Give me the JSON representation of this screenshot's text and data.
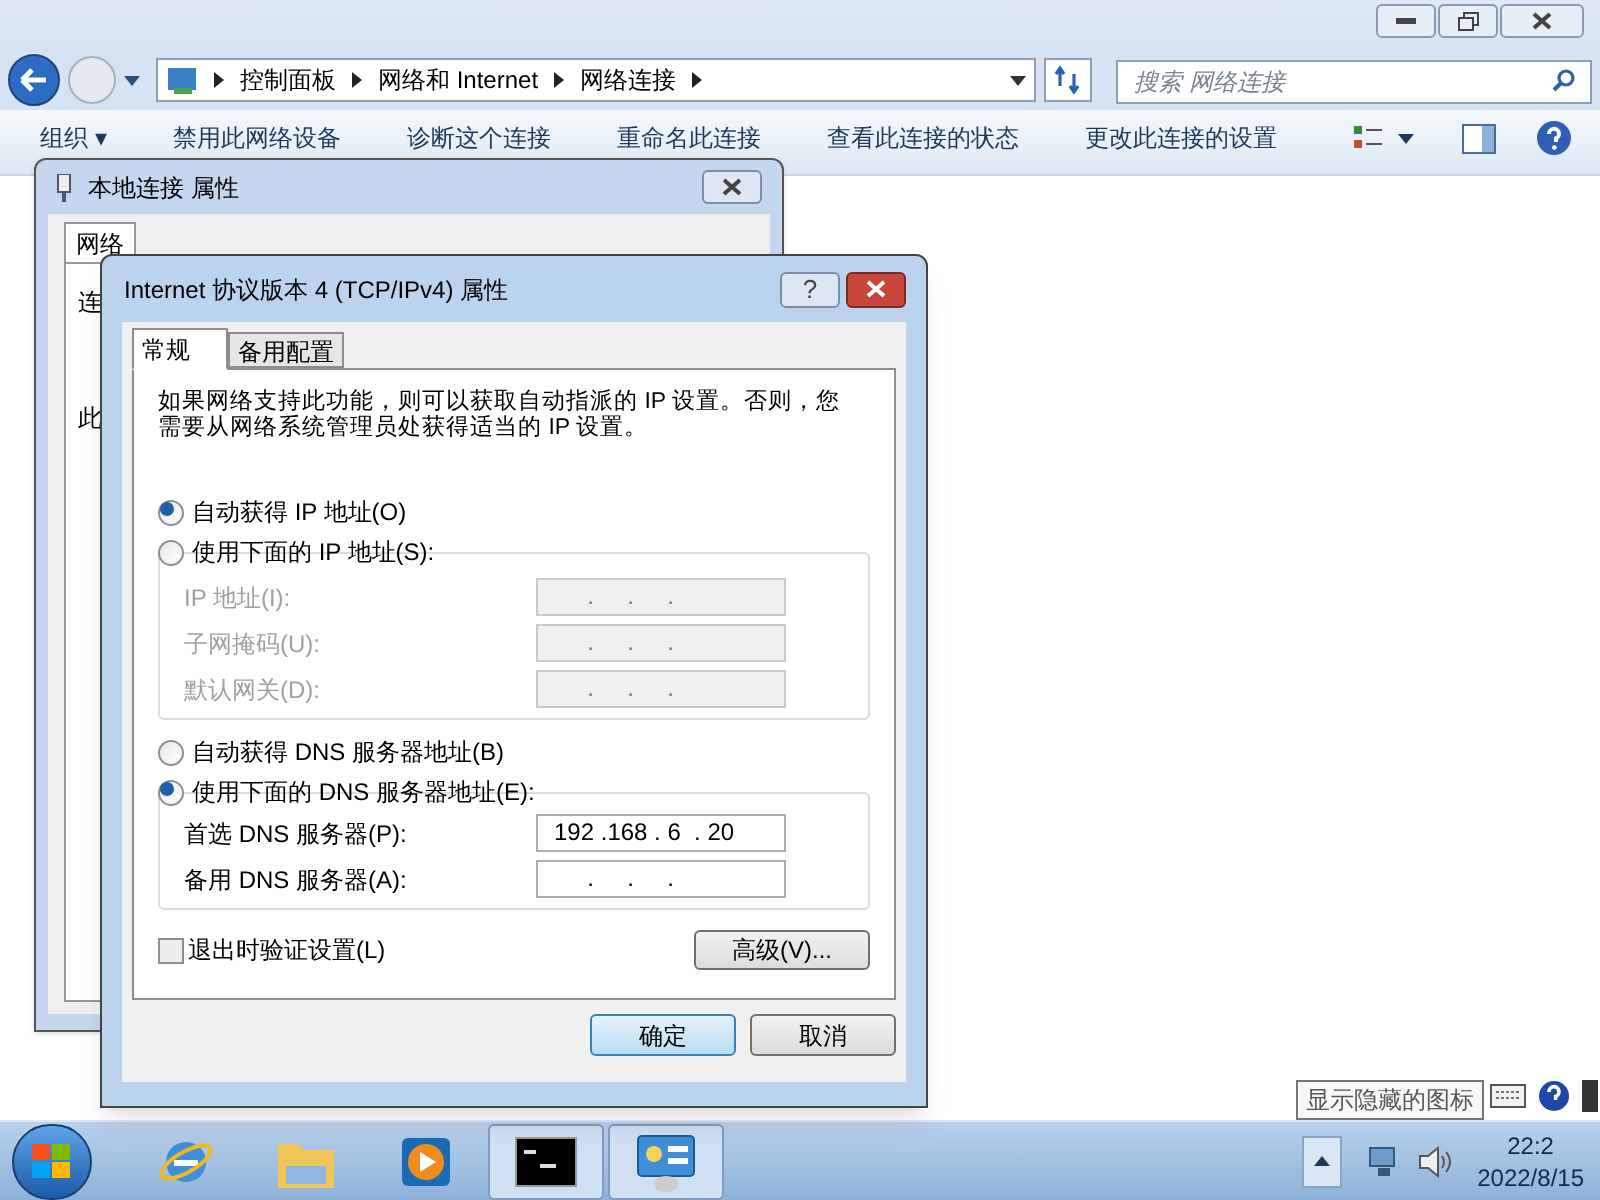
{
  "explorer": {
    "breadcrumb": [
      "控制面板",
      "网络和 Internet",
      "网络连接"
    ],
    "search": {
      "placeholder": "搜索 网络连接"
    },
    "toolbar": [
      {
        "label": "组织 ▾"
      },
      {
        "label": "禁用此网络设备"
      },
      {
        "label": "诊断这个连接"
      },
      {
        "label": "重命名此连接"
      },
      {
        "label": "查看此连接的状态"
      },
      {
        "label": "更改此连接的设置"
      }
    ]
  },
  "back_dialog": {
    "title": "本地连接 属性",
    "tabs": [
      {
        "label": "网络",
        "selected": true
      }
    ],
    "fragments": [
      "连",
      "此"
    ]
  },
  "dialog": {
    "title": "Internet 协议版本 4 (TCP/IPv4) 属性",
    "help": "?",
    "tabs": [
      {
        "label": "常规",
        "selected": true
      },
      {
        "label": "备用配置",
        "selected": false
      }
    ],
    "intro": "如果网络支持此功能，则可以获取自动指派的 IP 设置。否则，您需要从网络系统管理员处获得适当的 IP 设置。",
    "ip_options": [
      {
        "label": "自动获得 IP 地址(O)",
        "selected": true
      },
      {
        "label": "使用下面的 IP 地址(S):",
        "selected": false
      }
    ],
    "ip_fields": [
      {
        "label": "IP 地址(I):",
        "value": "     .     .     .",
        "disabled": true
      },
      {
        "label": "子网掩码(U):",
        "value": "     .     .     .",
        "disabled": true
      },
      {
        "label": "默认网关(D):",
        "value": "     .     .     .",
        "disabled": true
      }
    ],
    "dns_options": [
      {
        "label": "自动获得 DNS 服务器地址(B)",
        "selected": false
      },
      {
        "label": "使用下面的 DNS 服务器地址(E):",
        "selected": true
      }
    ],
    "dns_fields": [
      {
        "label": "首选 DNS 服务器(P):",
        "value": "192 .168 . 6  . 20",
        "disabled": false
      },
      {
        "label": "备用 DNS 服务器(A):",
        "value": "     .     .     .",
        "disabled": false
      }
    ],
    "validate": {
      "label": "退出时验证设置(L)",
      "checked": false
    },
    "advanced": "高级(V)...",
    "buttons": [
      {
        "label": "确定",
        "default": true
      },
      {
        "label": "取消",
        "default": false
      }
    ]
  },
  "tooltip": "显示隐藏的图标",
  "taskbar": {
    "apps": [
      {
        "kind": "ie",
        "active": false
      },
      {
        "kind": "folder",
        "active": false
      },
      {
        "kind": "media",
        "active": false
      },
      {
        "kind": "cmd",
        "active": true
      },
      {
        "kind": "panel",
        "active": true
      }
    ],
    "time": "22:2",
    "date": "2022/8/15"
  }
}
